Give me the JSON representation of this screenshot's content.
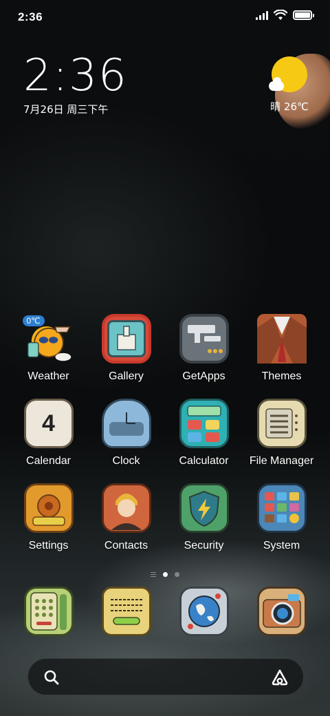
{
  "status_bar": {
    "time": "2:36",
    "icons": [
      "signal-icon",
      "wifi-icon",
      "battery-icon"
    ],
    "battery_level": 1.0
  },
  "clock_widget": {
    "time": "2:36",
    "date": "7月26日 周三下午"
  },
  "weather_widget": {
    "icon": "sunny-icon",
    "text": "晴 26℃",
    "badge_temp": "0℃"
  },
  "apps": [
    {
      "label": "Weather",
      "icon": "weather-icon"
    },
    {
      "label": "Gallery",
      "icon": "gallery-icon"
    },
    {
      "label": "GetApps",
      "icon": "getapps-icon"
    },
    {
      "label": "Themes",
      "icon": "themes-icon"
    },
    {
      "label": "Calendar",
      "icon": "calendar-icon",
      "day": "4"
    },
    {
      "label": "Clock",
      "icon": "clock-icon"
    },
    {
      "label": "Calculator",
      "icon": "calculator-icon"
    },
    {
      "label": "File Manager",
      "icon": "file-manager-icon"
    },
    {
      "label": "Settings",
      "icon": "settings-icon"
    },
    {
      "label": "Contacts",
      "icon": "contacts-icon"
    },
    {
      "label": "Security",
      "icon": "security-icon"
    },
    {
      "label": "System",
      "icon": "system-icon"
    }
  ],
  "page_indicator": {
    "pages": 2,
    "active": 1
  },
  "dock": [
    {
      "icon": "phone-icon"
    },
    {
      "icon": "messages-icon"
    },
    {
      "icon": "browser-icon"
    },
    {
      "icon": "camera-icon"
    }
  ],
  "search_bar": {
    "left_icon": "search-icon",
    "right_icon": "google-lens-icon"
  }
}
